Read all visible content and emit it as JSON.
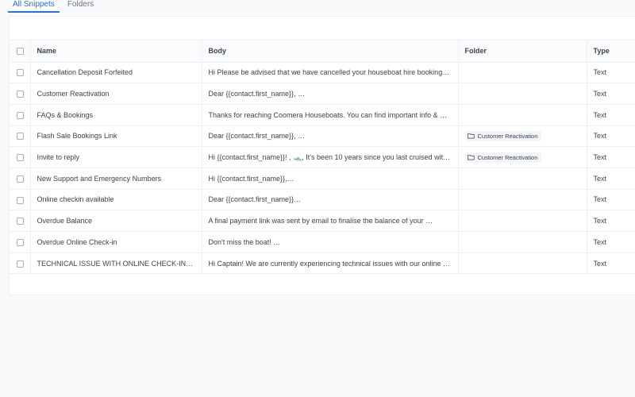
{
  "tabs": [
    {
      "label": "All Snippets",
      "active": true
    },
    {
      "label": "Folders",
      "active": false
    }
  ],
  "table": {
    "columns": [
      "Name",
      "Body",
      "Folder",
      "Type"
    ],
    "rows": [
      {
        "name": "Cancellation Deposit Forfeited",
        "body": "Hi Please be advised that we have cancelled your houseboat hire booking as …",
        "folder": "",
        "type": "Text"
      },
      {
        "name": "Customer Reactivation",
        "body": "Dear {{contact.first_name}}, …",
        "folder": "",
        "type": "Text"
      },
      {
        "name": "FAQs & Bookings",
        "body": "Thanks for reaching Coomera Houseboats. You can find important info & …",
        "folder": "",
        "type": "Text"
      },
      {
        "name": "Flash Sale Bookings Link",
        "body": "Dear {{contact.first_name}}, …",
        "folder": "Customer Reactivation",
        "type": "Text"
      },
      {
        "name": "Invite to reply",
        "body": "Hi {{contact.first_name}}! , 🛥️, It's been 10 years since you last cruised with …",
        "folder": "Customer Reactivation",
        "type": "Text"
      },
      {
        "name": "New Support and Emergency Numbers",
        "body": "Hi {{contact.first_name}},…",
        "folder": "",
        "type": "Text"
      },
      {
        "name": "Online checkin available",
        "body": "Dear {{contact.first_name}}…",
        "folder": "",
        "type": "Text"
      },
      {
        "name": "Overdue Balance",
        "body": " A final payment link was sent by email to finalise the balance of your …",
        "folder": "",
        "type": "Text"
      },
      {
        "name": "Overdue Online Check-in",
        "body": "Don't miss the boat! …",
        "folder": "",
        "type": "Text"
      },
      {
        "name": "TECHNICAL ISSUE WITH ONLINE CHECK-IN…",
        "body": "Hi Captain! We are currently experiencing technical issues with our online …",
        "folder": "",
        "type": "Text"
      }
    ]
  },
  "icons": {
    "folder": "folder-icon"
  },
  "colors": {
    "accent": "#2f6fd6"
  }
}
